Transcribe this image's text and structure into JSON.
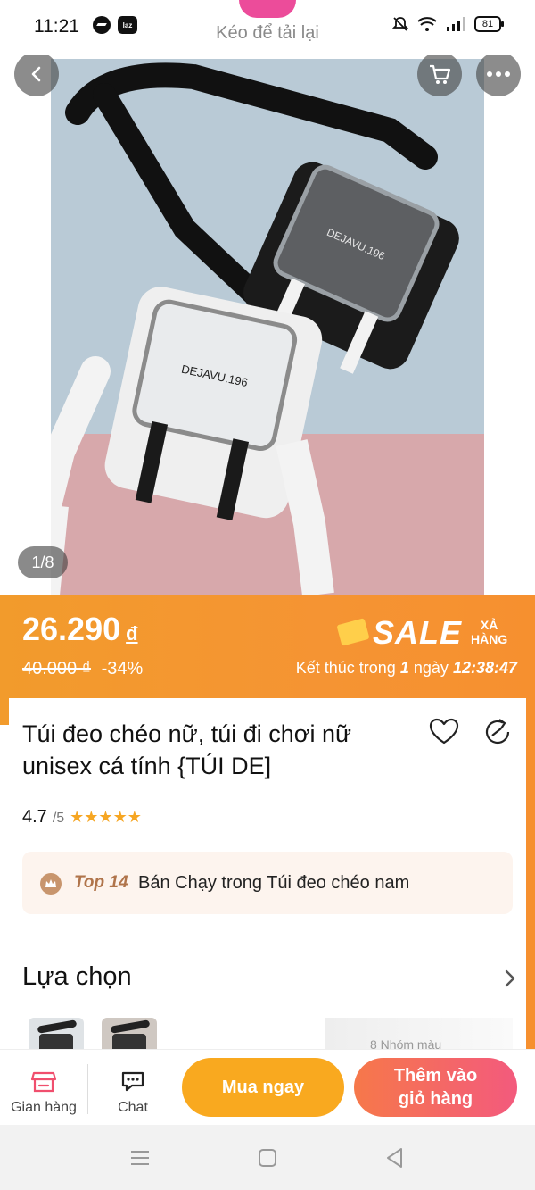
{
  "status_bar": {
    "time": "11:21",
    "laz_badge": "laz",
    "pull_to_refresh": "Kéo để tải lại",
    "battery": "81"
  },
  "gallery": {
    "counter": "1/8",
    "brand_print": "DEJAVU.196"
  },
  "price": {
    "current": "26.290",
    "currency": "đ",
    "original": "40.000 ₫",
    "discount": "-34%",
    "sale_word": "SALE",
    "sale_sub_line1": "XẢ",
    "sale_sub_line2": "HÀNG",
    "countdown_label": "Kết thúc trong",
    "countdown_days": "1",
    "countdown_days_unit": "ngày",
    "countdown_time": "12:38:47"
  },
  "product": {
    "title": "Túi đeo chéo nữ, túi đi chơi nữ unisex cá tính {TÚI DE]",
    "rating_value": "4.7",
    "rating_max": "/5",
    "stars": "★★★★★",
    "top_rank": "Top 14",
    "top_text": "Bán Chạy trong Túi đeo chéo nam"
  },
  "options": {
    "title": "Lựa chọn",
    "more": "8 Nhóm màu"
  },
  "action_bar": {
    "store_label": "Gian hàng",
    "chat_label": "Chat",
    "buy_now": "Mua ngay",
    "add_to_cart_line1": "Thêm vào",
    "add_to_cart_line2": "giỏ hàng"
  },
  "colors": {
    "orange": "#f29b2c",
    "buy_now": "#f9a91f",
    "add_cart": "#f35a7d",
    "star": "#f6a623"
  }
}
